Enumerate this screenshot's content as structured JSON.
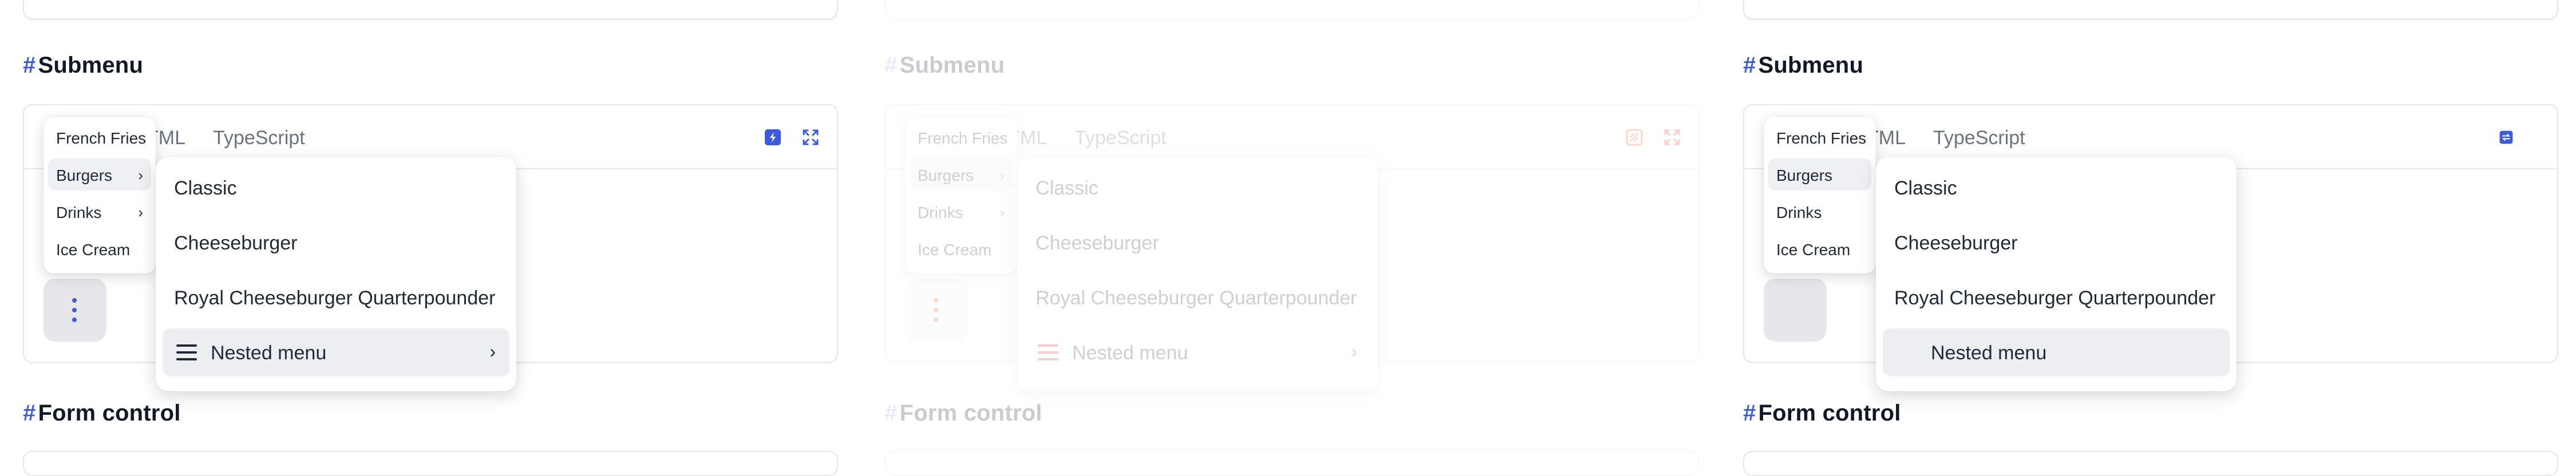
{
  "sections": {
    "submenu_title": "Submenu",
    "form_control_title": "Form control",
    "hash": "#"
  },
  "tabs": {
    "html_partial": "TML",
    "typescript": "TypeScript"
  },
  "food_menu": {
    "items": [
      {
        "label": "French Fries",
        "has_submenu": false
      },
      {
        "label": "Burgers",
        "has_submenu": true
      },
      {
        "label": "Drinks",
        "has_submenu": true
      },
      {
        "label": "Ice Cream",
        "has_submenu": false
      }
    ]
  },
  "burger_menu": {
    "items": [
      {
        "label": "Classic"
      },
      {
        "label": "Cheeseburger"
      },
      {
        "label": "Royal Cheeseburger Quarterpounder"
      },
      {
        "label": "Nested menu"
      }
    ]
  },
  "icons": {
    "chevron": "›",
    "theme_icon": "theme-toggle-icon",
    "expand_icon": "expand-icon",
    "more_icon": "more-vertical-icon",
    "menu_icon": "hamburger-menu-icon"
  },
  "colors": {
    "accent_blue": "#3b5bdb",
    "accent_orange": "#ea580c",
    "accent_red": "#dc2626"
  }
}
